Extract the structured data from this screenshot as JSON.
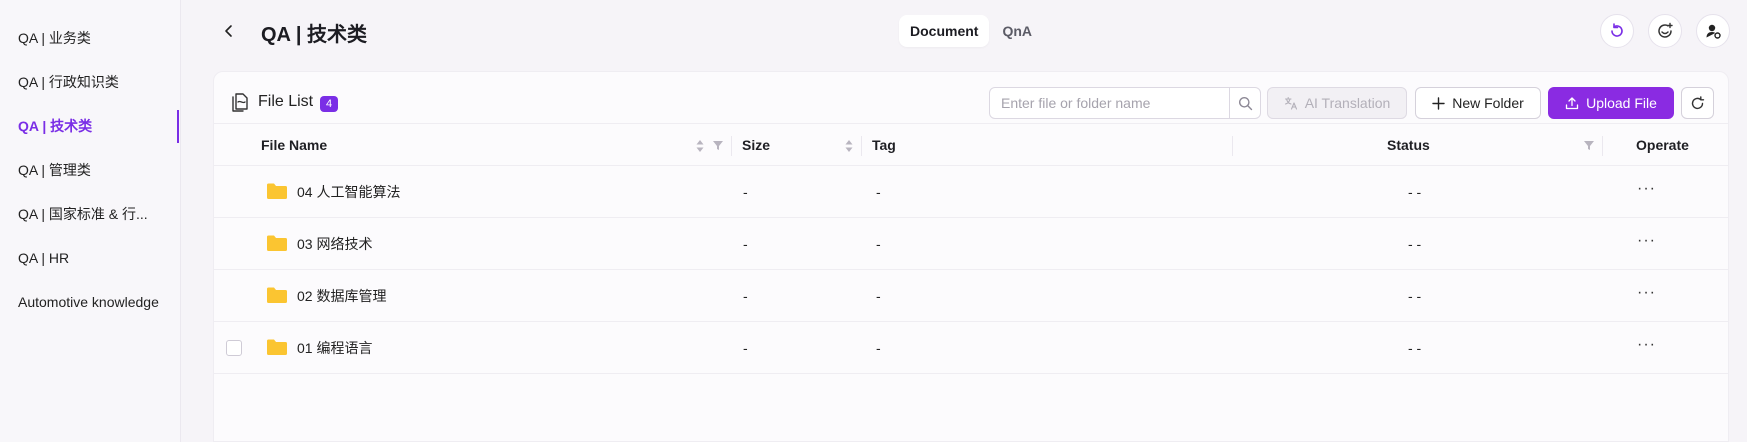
{
  "sidebar": {
    "items": [
      {
        "label": "QA | 业务类"
      },
      {
        "label": "QA | 行政知识类"
      },
      {
        "label": "QA | 技术类"
      },
      {
        "label": "QA | 管理类"
      },
      {
        "label": "QA | 国家标准 & 行..."
      },
      {
        "label": "QA | HR"
      },
      {
        "label": "Automotive knowledge"
      }
    ],
    "active_index": 2
  },
  "header": {
    "title": "QA | 技术类",
    "tabs": [
      {
        "label": "Document",
        "active": true
      },
      {
        "label": "QnA",
        "active": false
      }
    ],
    "icons": [
      "history-refresh-icon",
      "ai-chat-icon",
      "user-settings-icon"
    ]
  },
  "file_list": {
    "title": "File List",
    "count": "4",
    "search_placeholder": "Enter file or folder name",
    "ai_translation_label": "AI Translation",
    "new_folder_label": "New Folder",
    "upload_label": "Upload File"
  },
  "table": {
    "columns": {
      "name": "File Name",
      "size": "Size",
      "tag": "Tag",
      "status": "Status",
      "operate": "Operate"
    },
    "rows": [
      {
        "name": "04 人工智能算法",
        "size": "-",
        "tag": "-",
        "status": "- -",
        "operate": "···"
      },
      {
        "name": "03 网络技术",
        "size": "-",
        "tag": "-",
        "status": "- -",
        "operate": "···"
      },
      {
        "name": "02 数据库管理",
        "size": "-",
        "tag": "-",
        "status": "- -",
        "operate": "···"
      },
      {
        "name": "01 编程语言",
        "size": "-",
        "tag": "-",
        "status": "- -",
        "operate": "···"
      }
    ]
  },
  "colors": {
    "accent": "#7a2ee6",
    "upload_button": "#8a2be2",
    "folder": "#fbc531"
  }
}
